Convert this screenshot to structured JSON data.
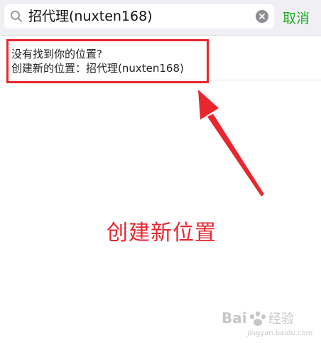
{
  "search": {
    "query": "招代理(nuxten168)",
    "cancel_label": "取消"
  },
  "suggestion": {
    "line1": "没有找到你的位置?",
    "line2": "创建新的位置：招代理(nuxten168)"
  },
  "annotation": {
    "text": "创建新位置"
  },
  "watermark": {
    "text": "Baidu 经验 jingyan.baidu.com"
  },
  "icons": {
    "search": "search-icon",
    "clear": "clear-icon"
  },
  "colors": {
    "accent_green": "#1aad19",
    "annotation_red": "#e8262d",
    "topbar_bg": "#efeff4"
  }
}
